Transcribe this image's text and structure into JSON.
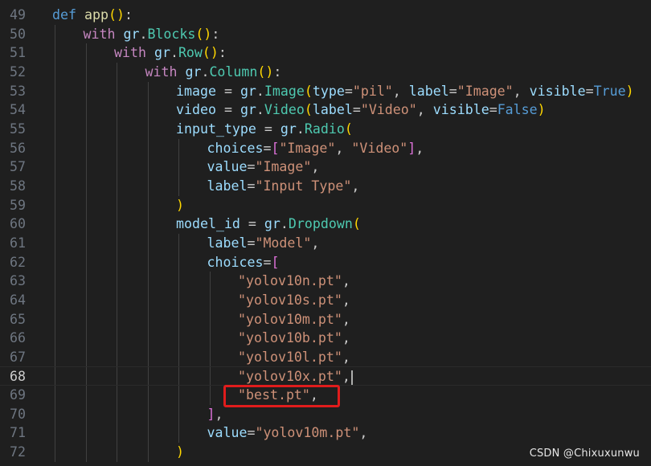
{
  "editor": {
    "current_line": 68,
    "lines": [
      {
        "n": "49",
        "indent": 0,
        "tokens": [
          [
            "kw",
            "def "
          ],
          [
            "fn",
            "app"
          ],
          [
            "b1",
            "()"
          ],
          [
            "p",
            ":"
          ]
        ]
      },
      {
        "n": "50",
        "indent": 1,
        "tokens": [
          [
            "ctl",
            "with "
          ],
          [
            "var",
            "gr"
          ],
          [
            "p",
            "."
          ],
          [
            "cls",
            "Blocks"
          ],
          [
            "b1",
            "()"
          ],
          [
            "p",
            ":"
          ]
        ]
      },
      {
        "n": "51",
        "indent": 2,
        "tokens": [
          [
            "ctl",
            "with "
          ],
          [
            "var",
            "gr"
          ],
          [
            "p",
            "."
          ],
          [
            "cls",
            "Row"
          ],
          [
            "b1",
            "()"
          ],
          [
            "p",
            ":"
          ]
        ]
      },
      {
        "n": "52",
        "indent": 3,
        "tokens": [
          [
            "ctl",
            "with "
          ],
          [
            "var",
            "gr"
          ],
          [
            "p",
            "."
          ],
          [
            "cls",
            "Column"
          ],
          [
            "b1",
            "()"
          ],
          [
            "p",
            ":"
          ]
        ]
      },
      {
        "n": "53",
        "indent": 4,
        "tokens": [
          [
            "var",
            "image"
          ],
          [
            "p",
            " = "
          ],
          [
            "var",
            "gr"
          ],
          [
            "p",
            "."
          ],
          [
            "cls",
            "Image"
          ],
          [
            "b1",
            "("
          ],
          [
            "var",
            "type"
          ],
          [
            "p",
            "="
          ],
          [
            "str",
            "\"pil\""
          ],
          [
            "p",
            ", "
          ],
          [
            "var",
            "label"
          ],
          [
            "p",
            "="
          ],
          [
            "str",
            "\"Image\""
          ],
          [
            "p",
            ", "
          ],
          [
            "var",
            "visible"
          ],
          [
            "p",
            "="
          ],
          [
            "kw",
            "True"
          ],
          [
            "b1",
            ")"
          ]
        ]
      },
      {
        "n": "54",
        "indent": 4,
        "tokens": [
          [
            "var",
            "video"
          ],
          [
            "p",
            " = "
          ],
          [
            "var",
            "gr"
          ],
          [
            "p",
            "."
          ],
          [
            "cls",
            "Video"
          ],
          [
            "b1",
            "("
          ],
          [
            "var",
            "label"
          ],
          [
            "p",
            "="
          ],
          [
            "str",
            "\"Video\""
          ],
          [
            "p",
            ", "
          ],
          [
            "var",
            "visible"
          ],
          [
            "p",
            "="
          ],
          [
            "kw",
            "False"
          ],
          [
            "b1",
            ")"
          ]
        ]
      },
      {
        "n": "55",
        "indent": 4,
        "tokens": [
          [
            "var",
            "input_type"
          ],
          [
            "p",
            " = "
          ],
          [
            "var",
            "gr"
          ],
          [
            "p",
            "."
          ],
          [
            "cls",
            "Radio"
          ],
          [
            "b1",
            "("
          ]
        ]
      },
      {
        "n": "56",
        "indent": 5,
        "tokens": [
          [
            "var",
            "choices"
          ],
          [
            "p",
            "="
          ],
          [
            "b2",
            "["
          ],
          [
            "str",
            "\"Image\""
          ],
          [
            "p",
            ", "
          ],
          [
            "str",
            "\"Video\""
          ],
          [
            "b2",
            "]"
          ],
          [
            "p",
            ","
          ]
        ]
      },
      {
        "n": "57",
        "indent": 5,
        "tokens": [
          [
            "var",
            "value"
          ],
          [
            "p",
            "="
          ],
          [
            "str",
            "\"Image\""
          ],
          [
            "p",
            ","
          ]
        ]
      },
      {
        "n": "58",
        "indent": 5,
        "tokens": [
          [
            "var",
            "label"
          ],
          [
            "p",
            "="
          ],
          [
            "str",
            "\"Input Type\""
          ],
          [
            "p",
            ","
          ]
        ]
      },
      {
        "n": "59",
        "indent": 4,
        "tokens": [
          [
            "b1",
            ")"
          ]
        ]
      },
      {
        "n": "60",
        "indent": 4,
        "tokens": [
          [
            "var",
            "model_id"
          ],
          [
            "p",
            " = "
          ],
          [
            "var",
            "gr"
          ],
          [
            "p",
            "."
          ],
          [
            "cls",
            "Dropdown"
          ],
          [
            "b1",
            "("
          ]
        ]
      },
      {
        "n": "61",
        "indent": 5,
        "tokens": [
          [
            "var",
            "label"
          ],
          [
            "p",
            "="
          ],
          [
            "str",
            "\"Model\""
          ],
          [
            "p",
            ","
          ]
        ]
      },
      {
        "n": "62",
        "indent": 5,
        "tokens": [
          [
            "var",
            "choices"
          ],
          [
            "p",
            "="
          ],
          [
            "b2",
            "["
          ]
        ]
      },
      {
        "n": "63",
        "indent": 6,
        "tokens": [
          [
            "str",
            "\"yolov10n.pt\""
          ],
          [
            "p",
            ","
          ]
        ]
      },
      {
        "n": "64",
        "indent": 6,
        "tokens": [
          [
            "str",
            "\"yolov10s.pt\""
          ],
          [
            "p",
            ","
          ]
        ]
      },
      {
        "n": "65",
        "indent": 6,
        "tokens": [
          [
            "str",
            "\"yolov10m.pt\""
          ],
          [
            "p",
            ","
          ]
        ]
      },
      {
        "n": "66",
        "indent": 6,
        "tokens": [
          [
            "str",
            "\"yolov10b.pt\""
          ],
          [
            "p",
            ","
          ]
        ]
      },
      {
        "n": "67",
        "indent": 6,
        "tokens": [
          [
            "str",
            "\"yolov10l.pt\""
          ],
          [
            "p",
            ","
          ]
        ]
      },
      {
        "n": "68",
        "indent": 6,
        "tokens": [
          [
            "str",
            "\"yolov10x.pt\""
          ],
          [
            "p",
            ","
          ]
        ],
        "cursor": true
      },
      {
        "n": "69",
        "indent": 6,
        "tokens": [
          [
            "str",
            "\"best.pt\""
          ],
          [
            "p",
            ","
          ]
        ]
      },
      {
        "n": "70",
        "indent": 5,
        "tokens": [
          [
            "b2",
            "]"
          ],
          [
            "p",
            ","
          ]
        ]
      },
      {
        "n": "71",
        "indent": 5,
        "tokens": [
          [
            "var",
            "value"
          ],
          [
            "p",
            "="
          ],
          [
            "str",
            "\"yolov10m.pt\""
          ],
          [
            "p",
            ","
          ]
        ]
      },
      {
        "n": "72",
        "indent": 4,
        "tokens": [
          [
            "b1",
            ")"
          ]
        ]
      }
    ]
  },
  "watermark": "CSDN @Chixuxunwu",
  "colors": {
    "background": "#1f1f1f",
    "line_number": "#6e7681",
    "keyword": "#569cd6",
    "control": "#c586c0",
    "function": "#dcdcaa",
    "variable": "#9cdcfe",
    "class": "#4ec9b0",
    "string": "#ce9178",
    "highlight_box": "#e01c1c"
  }
}
